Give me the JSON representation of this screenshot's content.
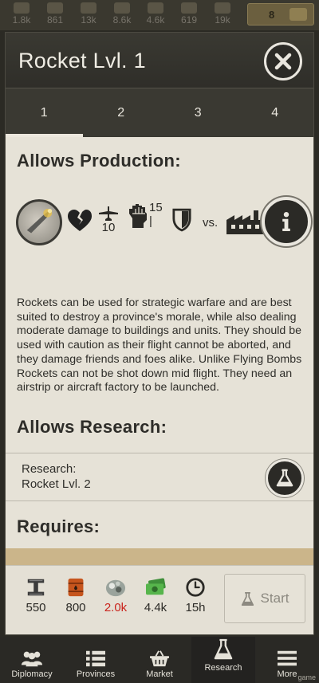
{
  "resources": [
    {
      "icon": "manpower-icon",
      "value": "1.8k"
    },
    {
      "icon": "supplies-icon",
      "value": "861"
    },
    {
      "icon": "components-icon",
      "value": "13k"
    },
    {
      "icon": "steel-icon",
      "value": "8.6k"
    },
    {
      "icon": "oil-icon",
      "value": "4.6k"
    },
    {
      "icon": "rare-materials-icon",
      "value": "619"
    },
    {
      "icon": "money-icon",
      "value": "19k"
    }
  ],
  "gold": {
    "value": "8"
  },
  "dialog": {
    "title": "Rocket Lvl. 1",
    "tabs": [
      {
        "label": "1",
        "active": true
      },
      {
        "label": "2",
        "active": false
      },
      {
        "label": "3",
        "active": false
      },
      {
        "label": "4",
        "active": false
      }
    ]
  },
  "production": {
    "heading": "Allows Production:",
    "airplane_value": "10",
    "fist_value": "15",
    "fist_sub": "|",
    "vs_label": "vs.",
    "description": "Rockets can be used for strategic warfare and are best suited to destroy a province's morale, while also dealing moderate damage to buildings and units. They should be used with caution as their flight cannot be aborted, and they damage friends and foes alike. Unlike Flying Bombs Rockets can not be shot down mid flight. They need an airstrip or aircraft factory to be launched."
  },
  "research": {
    "heading": "Allows Research:",
    "label": "Research:",
    "item": "Rocket Lvl. 2"
  },
  "requires": {
    "heading": "Requires:"
  },
  "cost": {
    "steel": "550",
    "oil": "800",
    "rare": "2.0k",
    "money": "4.4k",
    "time": "15h",
    "start_label": "Start",
    "rare_color": "#c9221b"
  },
  "nav": [
    {
      "label": "Diplomacy",
      "icon": "people-icon"
    },
    {
      "label": "Provinces",
      "icon": "list-icon"
    },
    {
      "label": "Market",
      "icon": "basket-icon"
    },
    {
      "label": "Research",
      "icon": "flask-icon",
      "active": true
    },
    {
      "label": "More",
      "icon": "menu-icon"
    }
  ],
  "watermark": "game"
}
